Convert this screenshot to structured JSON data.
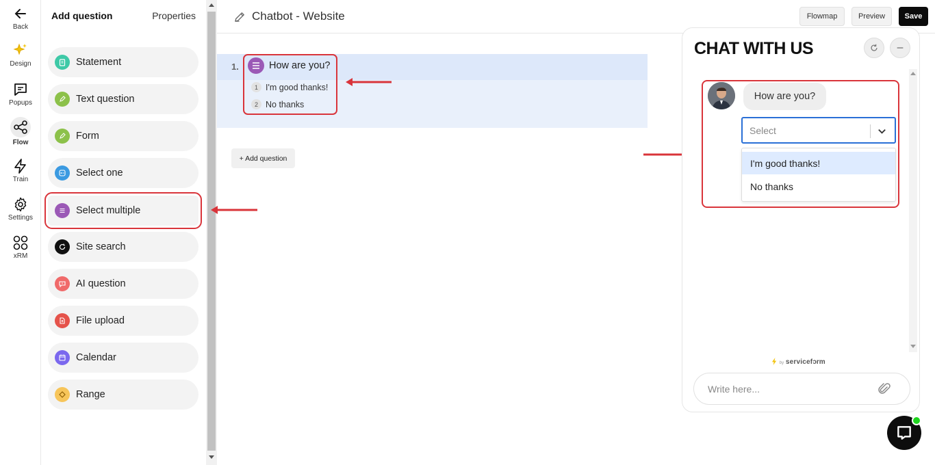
{
  "rail": {
    "back": "Back",
    "items": [
      {
        "label": "Design",
        "icon": "sparkle-icon"
      },
      {
        "label": "Popups",
        "icon": "chat-square-icon"
      },
      {
        "label": "Flow",
        "icon": "share-nodes-icon",
        "active": true
      },
      {
        "label": "Train",
        "icon": "lightning-icon"
      },
      {
        "label": "Settings",
        "icon": "gear-icon"
      },
      {
        "label": "xRM",
        "icon": "grid-icon"
      }
    ]
  },
  "panel": {
    "tab_add": "Add question",
    "tab_properties": "Properties",
    "question_types": [
      {
        "label": "Statement",
        "color": "#3ec9a7"
      },
      {
        "label": "Text question",
        "color": "#8cc14a"
      },
      {
        "label": "Form",
        "color": "#8cc14a"
      },
      {
        "label": "Select one",
        "color": "#3b9ae1"
      },
      {
        "label": "Select multiple",
        "color": "#9b59b6",
        "highlighted": true
      },
      {
        "label": "Site search",
        "color": "#111111"
      },
      {
        "label": "AI question",
        "color": "#f06a6a"
      },
      {
        "label": "File upload",
        "color": "#e5534b"
      },
      {
        "label": "Calendar",
        "color": "#7b68ee"
      },
      {
        "label": "Range",
        "color": "#f7c55a"
      }
    ]
  },
  "header": {
    "title": "Chatbot - Website",
    "flowmap": "Flowmap",
    "preview": "Preview",
    "save": "Save"
  },
  "canvas": {
    "question_number": "1.",
    "question_title": "How are you?",
    "options": [
      {
        "n": "1",
        "label": "I'm good thanks!"
      },
      {
        "n": "2",
        "label": "No thanks"
      }
    ],
    "add_question": "+ Add question"
  },
  "chat": {
    "title": "CHAT WITH US",
    "message": "How are you?",
    "select_placeholder": "Select",
    "dropdown_options": [
      "I'm good thanks!",
      "No thanks"
    ],
    "powered_by": "servicef",
    "powered_small": "by",
    "input_placeholder": "Write here..."
  },
  "colors": {
    "highlight": "#d9343a",
    "accent_blue": "#2a6fd6",
    "online": "#1fd51f"
  }
}
